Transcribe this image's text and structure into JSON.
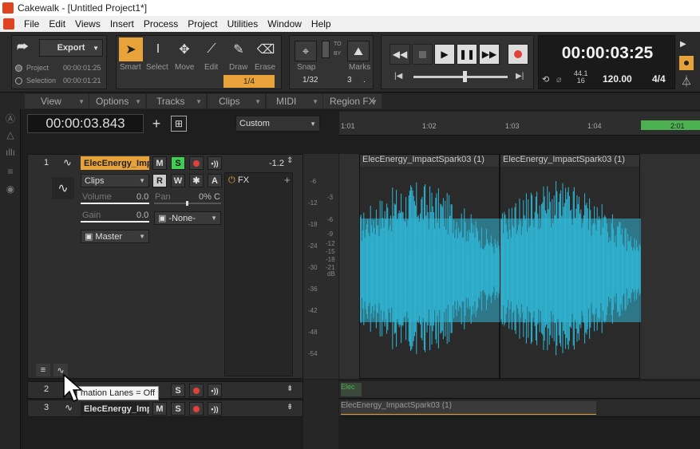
{
  "window": {
    "title": "Cakewalk - [Untitled Project1*]"
  },
  "menu": [
    "File",
    "Edit",
    "Views",
    "Insert",
    "Process",
    "Project",
    "Utilities",
    "Window",
    "Help"
  ],
  "export": {
    "label": "Export",
    "project_label": "Project",
    "project_time": "00:00:01:25",
    "selection_label": "Selection",
    "selection_time": "00:00:01:21"
  },
  "tools": [
    {
      "label": "Smart",
      "icon": "smart-arrow-icon"
    },
    {
      "label": "Select",
      "icon": "select-cursor-icon"
    },
    {
      "label": "Move",
      "icon": "move-arrows-icon"
    },
    {
      "label": "Edit",
      "icon": "edit-icon"
    },
    {
      "label": "Draw",
      "icon": "draw-pencil-icon"
    },
    {
      "label": "Erase",
      "icon": "erase-icon"
    }
  ],
  "tool_resolution": "1/4",
  "snap": {
    "label": "Snap",
    "value": "1/32",
    "count": "3",
    "marks_label": "Marks",
    "to_label": "TO",
    "by_label": "BY"
  },
  "transport": {
    "time": "00:00:03:25",
    "sample_rate_top": "44.1",
    "sample_rate_bottom": "16",
    "tempo": "120.00",
    "meter": "4/4"
  },
  "views_bar": [
    "View",
    "Options",
    "Tracks",
    "Clips",
    "MIDI",
    "Region FX"
  ],
  "now_time": "00:00:03.843",
  "custom_select": "Custom",
  "ruler": [
    "1:01",
    "1:02",
    "1:03",
    "1:04",
    "2:01"
  ],
  "track1": {
    "num": "1",
    "name": "ElecEnergy_Impa",
    "mute": "M",
    "solo": "S",
    "clips_dd": "Clips",
    "read": "R",
    "write": "W",
    "a_label": "A",
    "volume_label": "Volume",
    "volume_value": "0.0",
    "pan_label": "Pan",
    "pan_value": "0% C",
    "gain_label": "Gain",
    "gain_value": "0.0",
    "input_dd": "-None-",
    "output_dd": "Master",
    "fx_label": "FX",
    "trim_value": "-1.2"
  },
  "track2": {
    "num": "2",
    "mute": "M",
    "solo": "S"
  },
  "track3": {
    "num": "3",
    "name": "ElecEnergy_Impa",
    "mute": "M",
    "solo": "S"
  },
  "meter_ticks": [
    "-6",
    "-12",
    "-18",
    "-24",
    "-30",
    "-36",
    "-42",
    "-48",
    "-54"
  ],
  "meter_right_ticks": [
    "-3",
    "-6",
    "-9",
    "-12",
    "-15",
    "-18",
    "-21",
    "dB"
  ],
  "clips": {
    "clip_a": "ElecEnergy_ImpactSpark03 (1)",
    "clip_b": "ElecEnergy_ImpactSpark03 (1)",
    "track2_clip": "Elec",
    "track3_clip": "ElecEnergy_ImpactSpark03 (1)"
  },
  "tooltip": "mation Lanes = Off",
  "colors": {
    "accent": "#e8a23a",
    "waveform": "#2fb6d6",
    "solo_on": "#3fce52",
    "record": "#e0413a"
  }
}
